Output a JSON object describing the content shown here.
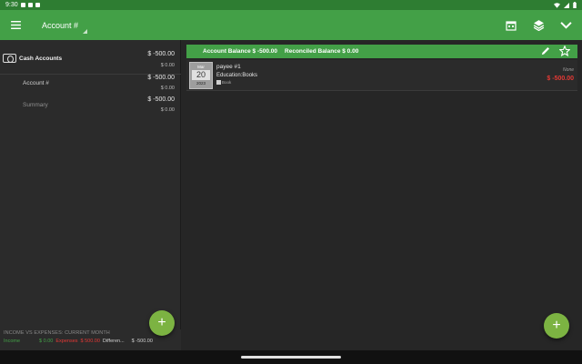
{
  "statusbar": {
    "time": "9:30"
  },
  "appbar": {
    "account_title": "Account #"
  },
  "left": {
    "cash": {
      "label": "Cash Accounts",
      "amount": "$ -500.00",
      "sub": "$ 0.00"
    },
    "account": {
      "label": "Account #",
      "amount": "$ -500.00",
      "sub": "$ 0.00"
    },
    "summary": {
      "label": "Summary",
      "amount": "$ -500.00",
      "sub": "$ 0.00"
    },
    "footer": {
      "title": "INCOME VS EXPENSES: CURRENT MONTH",
      "income_label": "Income",
      "income_value": "$ 0.00",
      "expenses_label": "Expenses",
      "expenses_value": "$ 500.00",
      "difference_label": "Differen...",
      "difference_value": "$ -500.00"
    }
  },
  "balance_bar": {
    "account_balance": "Account Balance $ -500.00",
    "reconciled_balance": "Reconciled Balance $ 0.00"
  },
  "transaction": {
    "month": "Mar",
    "day": "20",
    "year": "2023",
    "payee": "payee #1",
    "category": "Education:Books",
    "tag": "Book",
    "status": "None",
    "amount": "$ -500.00"
  },
  "fab": {
    "label": "+"
  },
  "colors": {
    "primary": "#43a047",
    "status_bar": "#2e7d32",
    "accent": "#7cb342",
    "negative": "#e53935"
  }
}
